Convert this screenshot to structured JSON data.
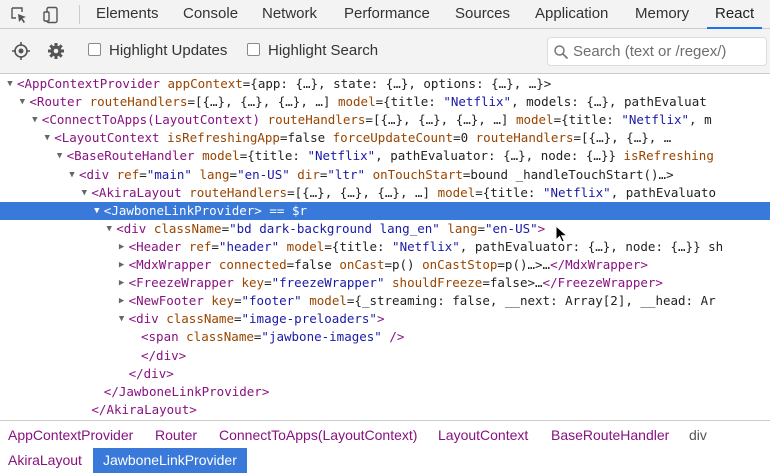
{
  "tabs": [
    {
      "label": "Elements",
      "active": false
    },
    {
      "label": "Console",
      "active": false
    },
    {
      "label": "Network",
      "active": false
    },
    {
      "label": "Performance",
      "active": false
    },
    {
      "label": "Sources",
      "active": false
    },
    {
      "label": "Application",
      "active": false
    },
    {
      "label": "Memory",
      "active": false
    },
    {
      "label": "React",
      "active": true
    }
  ],
  "toolbar": {
    "highlight_updates": "Highlight Updates",
    "highlight_search": "Highlight Search",
    "search_placeholder": "Search (text or /regex/)"
  },
  "tree": [
    {
      "arrow": "open",
      "selected": false,
      "segs": [
        {
          "t": "<AppContextProvider ",
          "c": "tag"
        },
        {
          "t": "appContext",
          "c": "attr"
        },
        {
          "t": "={app: {…}, state: {…}, options: {…}, …}>",
          "c": "txt"
        }
      ]
    },
    {
      "arrow": "open",
      "selected": false,
      "segs": [
        {
          "t": "<Router ",
          "c": "tag"
        },
        {
          "t": "routeHandlers",
          "c": "attr"
        },
        {
          "t": "=[{…}, {…}, {…}, …] ",
          "c": "txt"
        },
        {
          "t": "model",
          "c": "attr"
        },
        {
          "t": "={title: ",
          "c": "txt"
        },
        {
          "t": "\"Netflix\"",
          "c": "val"
        },
        {
          "t": ", models: {…}, pathEvaluat",
          "c": "txt"
        }
      ]
    },
    {
      "arrow": "open",
      "selected": false,
      "segs": [
        {
          "t": "<ConnectToApps(LayoutContext) ",
          "c": "tag"
        },
        {
          "t": "routeHandlers",
          "c": "attr"
        },
        {
          "t": "=[{…}, {…}, {…}, …] ",
          "c": "txt"
        },
        {
          "t": "model",
          "c": "attr"
        },
        {
          "t": "={title: ",
          "c": "txt"
        },
        {
          "t": "\"Netflix\"",
          "c": "val"
        },
        {
          "t": ", m",
          "c": "txt"
        }
      ]
    },
    {
      "arrow": "open",
      "selected": false,
      "segs": [
        {
          "t": "<LayoutContext ",
          "c": "tag"
        },
        {
          "t": "isRefreshingApp",
          "c": "attr"
        },
        {
          "t": "=false ",
          "c": "txt"
        },
        {
          "t": "forceUpdateCount",
          "c": "attr"
        },
        {
          "t": "=0 ",
          "c": "txt"
        },
        {
          "t": "routeHandlers",
          "c": "attr"
        },
        {
          "t": "=[{…}, {…}, …",
          "c": "txt"
        }
      ]
    },
    {
      "arrow": "open",
      "selected": false,
      "segs": [
        {
          "t": "<BaseRouteHandler ",
          "c": "tag"
        },
        {
          "t": "model",
          "c": "attr"
        },
        {
          "t": "={title: ",
          "c": "txt"
        },
        {
          "t": "\"Netflix\"",
          "c": "val"
        },
        {
          "t": ", pathEvaluator: {…}, node: {…}} ",
          "c": "txt"
        },
        {
          "t": "isRefreshing",
          "c": "attr"
        }
      ]
    },
    {
      "arrow": "open",
      "selected": false,
      "segs": [
        {
          "t": "<div ",
          "c": "tag"
        },
        {
          "t": "ref",
          "c": "attr"
        },
        {
          "t": "=",
          "c": "txt"
        },
        {
          "t": "\"main\"",
          "c": "val"
        },
        {
          "t": " ",
          "c": "txt"
        },
        {
          "t": "lang",
          "c": "attr"
        },
        {
          "t": "=",
          "c": "txt"
        },
        {
          "t": "\"en-US\"",
          "c": "val"
        },
        {
          "t": " ",
          "c": "txt"
        },
        {
          "t": "dir",
          "c": "attr"
        },
        {
          "t": "=",
          "c": "txt"
        },
        {
          "t": "\"ltr\"",
          "c": "val"
        },
        {
          "t": " ",
          "c": "txt"
        },
        {
          "t": "onTouchStart",
          "c": "attr"
        },
        {
          "t": "=bound _handleTouchStart()…>",
          "c": "txt"
        }
      ]
    },
    {
      "arrow": "open",
      "selected": false,
      "segs": [
        {
          "t": "<AkiraLayout ",
          "c": "tag"
        },
        {
          "t": "routeHandlers",
          "c": "attr"
        },
        {
          "t": "=[{…}, {…}, {…}, …] ",
          "c": "txt"
        },
        {
          "t": "model",
          "c": "attr"
        },
        {
          "t": "={title: ",
          "c": "txt"
        },
        {
          "t": "\"Netflix\"",
          "c": "val"
        },
        {
          "t": ", pathEvaluato",
          "c": "txt"
        }
      ]
    },
    {
      "arrow": "open",
      "selected": true,
      "segs": [
        {
          "t": "<JawboneLinkProvider>",
          "c": "tag"
        },
        {
          "t": " == $r",
          "c": "txt"
        }
      ]
    },
    {
      "arrow": "open",
      "selected": false,
      "segs": [
        {
          "t": "<div ",
          "c": "tag"
        },
        {
          "t": "className",
          "c": "attr"
        },
        {
          "t": "=",
          "c": "txt"
        },
        {
          "t": "\"bd dark-background lang_en\"",
          "c": "val"
        },
        {
          "t": " ",
          "c": "txt"
        },
        {
          "t": "lang",
          "c": "attr"
        },
        {
          "t": "=",
          "c": "txt"
        },
        {
          "t": "\"en-US\"",
          "c": "val"
        },
        {
          "t": ">",
          "c": "tag"
        }
      ]
    },
    {
      "arrow": "closed",
      "selected": false,
      "segs": [
        {
          "t": "<Header ",
          "c": "tag"
        },
        {
          "t": "ref",
          "c": "attr"
        },
        {
          "t": "=",
          "c": "txt"
        },
        {
          "t": "\"header\"",
          "c": "val"
        },
        {
          "t": " ",
          "c": "txt"
        },
        {
          "t": "model",
          "c": "attr"
        },
        {
          "t": "={title: ",
          "c": "txt"
        },
        {
          "t": "\"Netflix\"",
          "c": "val"
        },
        {
          "t": ", pathEvaluator: {…}, node: {…}} sh",
          "c": "txt"
        }
      ]
    },
    {
      "arrow": "closed",
      "selected": false,
      "segs": [
        {
          "t": "<MdxWrapper ",
          "c": "tag"
        },
        {
          "t": "connected",
          "c": "attr"
        },
        {
          "t": "=false ",
          "c": "txt"
        },
        {
          "t": "onCast",
          "c": "attr"
        },
        {
          "t": "=p() ",
          "c": "txt"
        },
        {
          "t": "onCastStop",
          "c": "attr"
        },
        {
          "t": "=p()…>…",
          "c": "txt"
        },
        {
          "t": "</MdxWrapper>",
          "c": "tag"
        }
      ]
    },
    {
      "arrow": "closed",
      "selected": false,
      "segs": [
        {
          "t": "<FreezeWrapper ",
          "c": "tag"
        },
        {
          "t": "key",
          "c": "attr"
        },
        {
          "t": "=",
          "c": "txt"
        },
        {
          "t": "\"freezeWrapper\"",
          "c": "val"
        },
        {
          "t": " ",
          "c": "txt"
        },
        {
          "t": "shouldFreeze",
          "c": "attr"
        },
        {
          "t": "=false>…",
          "c": "txt"
        },
        {
          "t": "</FreezeWrapper>",
          "c": "tag"
        }
      ]
    },
    {
      "arrow": "closed",
      "selected": false,
      "segs": [
        {
          "t": "<NewFooter ",
          "c": "tag"
        },
        {
          "t": "key",
          "c": "attr"
        },
        {
          "t": "=",
          "c": "txt"
        },
        {
          "t": "\"footer\"",
          "c": "val"
        },
        {
          "t": " ",
          "c": "txt"
        },
        {
          "t": "model",
          "c": "attr"
        },
        {
          "t": "={_streaming: false, __next: Array[2], __head: Ar",
          "c": "txt"
        }
      ]
    },
    {
      "arrow": "open",
      "selected": false,
      "segs": [
        {
          "t": "<div ",
          "c": "tag"
        },
        {
          "t": "className",
          "c": "attr"
        },
        {
          "t": "=",
          "c": "txt"
        },
        {
          "t": "\"image-preloaders\"",
          "c": "val"
        },
        {
          "t": ">",
          "c": "tag"
        }
      ]
    },
    {
      "arrow": "none",
      "selected": false,
      "segs": [
        {
          "t": "<span ",
          "c": "tag"
        },
        {
          "t": "className",
          "c": "attr"
        },
        {
          "t": "=",
          "c": "txt"
        },
        {
          "t": "\"jawbone-images\"",
          "c": "val"
        },
        {
          "t": " />",
          "c": "tag"
        }
      ]
    },
    {
      "arrow": "none",
      "selected": false,
      "segs": [
        {
          "t": "</div>",
          "c": "tag"
        }
      ]
    },
    {
      "arrow": "none",
      "selected": false,
      "segs": [
        {
          "t": "</div>",
          "c": "tag"
        }
      ]
    },
    {
      "arrow": "none",
      "selected": false,
      "segs": [
        {
          "t": "</JawboneLinkProvider>",
          "c": "tag"
        }
      ]
    },
    {
      "arrow": "none",
      "selected": false,
      "segs": [
        {
          "t": "</AkiraLayout>",
          "c": "tag"
        }
      ]
    }
  ],
  "breadcrumbs": [
    {
      "label": "AppContextProvider",
      "kind": "component"
    },
    {
      "label": "Router",
      "kind": "component"
    },
    {
      "label": "ConnectToApps(LayoutContext)",
      "kind": "component"
    },
    {
      "label": "LayoutContext",
      "kind": "component"
    },
    {
      "label": "BaseRouteHandler",
      "kind": "component"
    },
    {
      "label": "div",
      "kind": "dom"
    },
    {
      "label": "AkiraLayout",
      "kind": "component"
    },
    {
      "label": "JawboneLinkProvider",
      "kind": "active"
    }
  ],
  "colors": {
    "tag": "#881280",
    "attr": "#994500",
    "value": "#1a1aa6",
    "selection": "#3879d9"
  }
}
